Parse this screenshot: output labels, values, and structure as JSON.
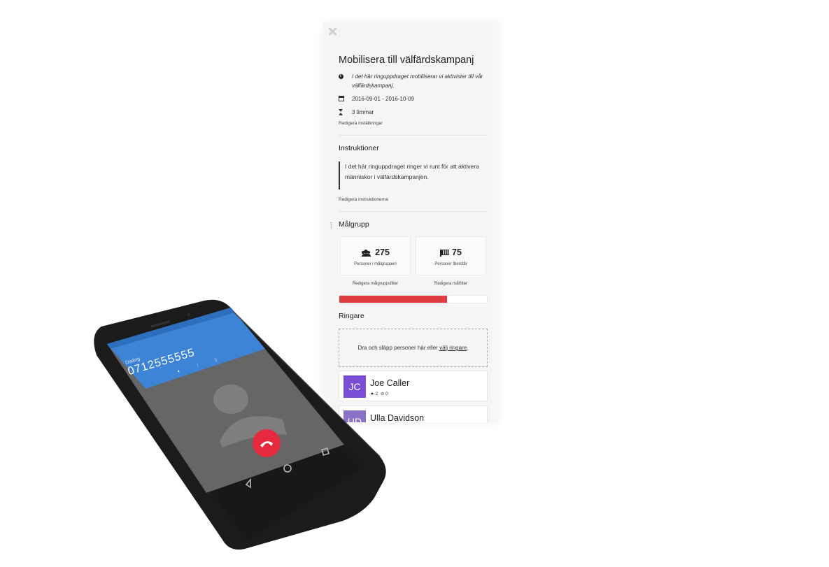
{
  "panel": {
    "title": "Mobilisera till välfärdskampanj",
    "description": "I det här ringuppdraget mobiliserar vi aktivister till vår välfärdskampanj.",
    "date_range": "2016-09-01 - 2016-10-09",
    "duration": "3 timmar",
    "edit_settings_label": "Redigera inställningar",
    "instructions": {
      "heading": "Instruktioner",
      "text": "I det här ringuppdraget ringer vi runt för att aktivera människor i välfärdskampanjen.",
      "edit_label": "Redigera instruktionerna"
    },
    "target": {
      "heading": "Målgrupp",
      "people_in_target": "275",
      "people_in_target_label": "Personer i målgruppen",
      "people_remaining": "75",
      "people_remaining_label": "Personer återstår",
      "edit_filters_label": "Redigera målgruppsfilter",
      "edit_goal_filters_label": "Redigera målfilter",
      "progress_fraction": 0.73
    },
    "callers": {
      "heading": "Ringare",
      "drop_text": "Dra och släpp personer här eller ",
      "drop_link": "välj ringare",
      "drop_suffix": ".",
      "list": [
        {
          "initials": "JC",
          "name": "Joe Caller",
          "stars": "2",
          "blocked": "0",
          "color": "#7b4ed6"
        },
        {
          "initials": "UD",
          "name": "Ulla Davidson",
          "stars": "",
          "blocked": "",
          "color": "#8a73c6"
        }
      ]
    }
  },
  "phone": {
    "status": "Dialing",
    "number": "0712555555",
    "colors": {
      "header": "#3d84d6",
      "screen": "#666666",
      "hangup": "#e52a40"
    }
  },
  "colors": {
    "progress": "#e03b41",
    "panel_bg": "#f5f5f5"
  }
}
